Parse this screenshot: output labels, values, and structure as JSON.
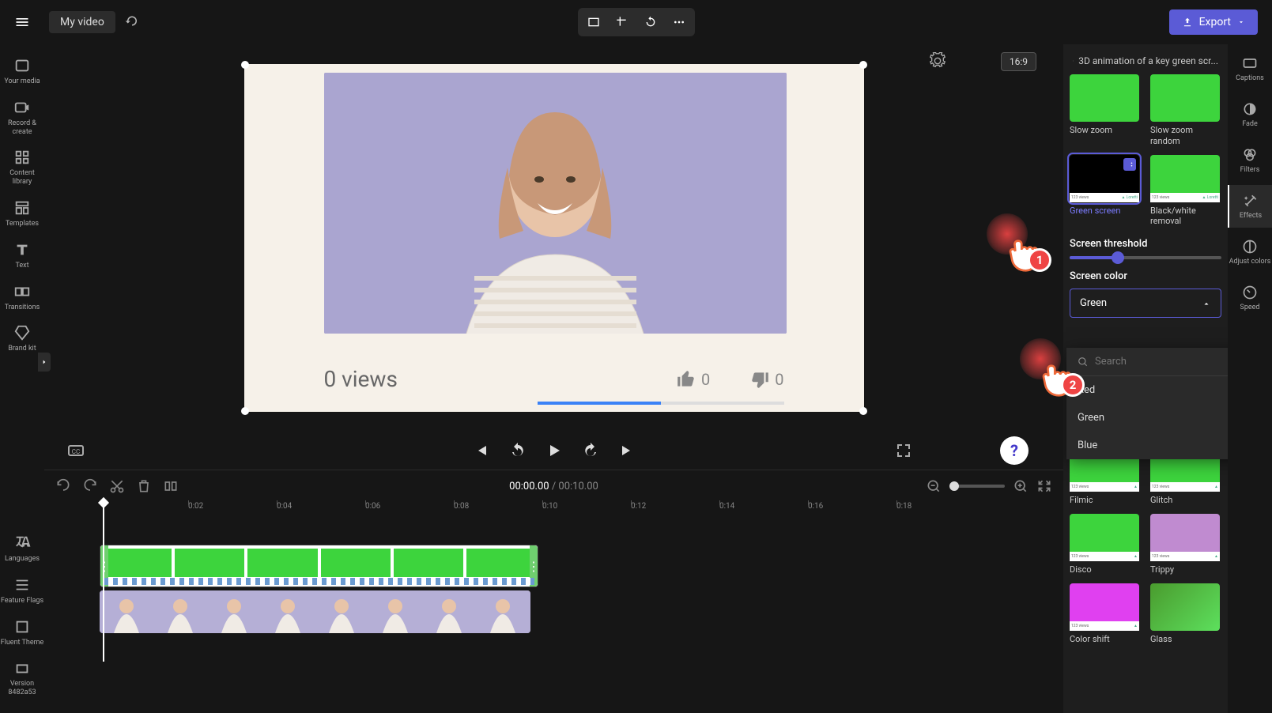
{
  "header": {
    "project_title": "My video",
    "export_label": "Export"
  },
  "left_sidebar": {
    "items": [
      {
        "label": "Your media"
      },
      {
        "label": "Record & create"
      },
      {
        "label": "Content library"
      },
      {
        "label": "Templates"
      },
      {
        "label": "Text"
      },
      {
        "label": "Transitions"
      },
      {
        "label": "Brand kit"
      }
    ],
    "bottom_items": [
      {
        "label": "Languages"
      },
      {
        "label": "Feature Flags"
      },
      {
        "label": "Fluent Theme"
      },
      {
        "label": "Version 8482a53"
      }
    ]
  },
  "canvas": {
    "aspect_ratio": "16:9",
    "views_text": "0 views",
    "like_count": "0",
    "dislike_count": "0"
  },
  "playback": {
    "current_time": "00:00.00",
    "duration": "00:10.00"
  },
  "timeline": {
    "ticks": [
      "0:02",
      "0:04",
      "0:06",
      "0:08",
      "0:10",
      "0:12",
      "0:14",
      "0:16",
      "0:18"
    ]
  },
  "effects_panel": {
    "title": "3D animation of a key green scr...",
    "threshold_label": "Screen threshold",
    "color_label": "Screen color",
    "color_value": "Green",
    "search_placeholder": "Search",
    "color_options": [
      "Red",
      "Green",
      "Blue"
    ],
    "effects_top": [
      {
        "label": "Slow zoom"
      },
      {
        "label": "Slow zoom random"
      },
      {
        "label": "Green screen",
        "selected": true
      },
      {
        "label": "Black/white removal"
      }
    ],
    "effects_bottom": [
      {
        "label": "Filmic"
      },
      {
        "label": "Glitch"
      },
      {
        "label": "Disco"
      },
      {
        "label": "Trippy"
      },
      {
        "label": "Color shift"
      },
      {
        "label": "Glass"
      }
    ]
  },
  "right_rail": {
    "items": [
      {
        "label": "Captions"
      },
      {
        "label": "Fade"
      },
      {
        "label": "Filters"
      },
      {
        "label": "Effects",
        "active": true
      },
      {
        "label": "Adjust colors"
      },
      {
        "label": "Speed"
      }
    ]
  },
  "annotations": {
    "p1": "1",
    "p2": "2"
  }
}
